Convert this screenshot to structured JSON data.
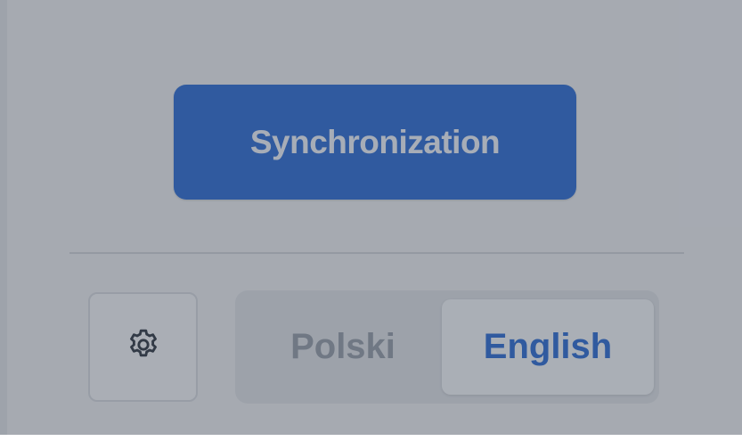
{
  "sync_button": {
    "label": "Synchronization"
  },
  "settings": {
    "icon": "gear-icon"
  },
  "language_switch": {
    "options": [
      {
        "label": "Polski",
        "selected": false
      },
      {
        "label": "English",
        "selected": true
      }
    ]
  },
  "colors": {
    "accent": "#2f6fd8",
    "overlay": "rgba(50, 60, 75, 0.40)"
  }
}
